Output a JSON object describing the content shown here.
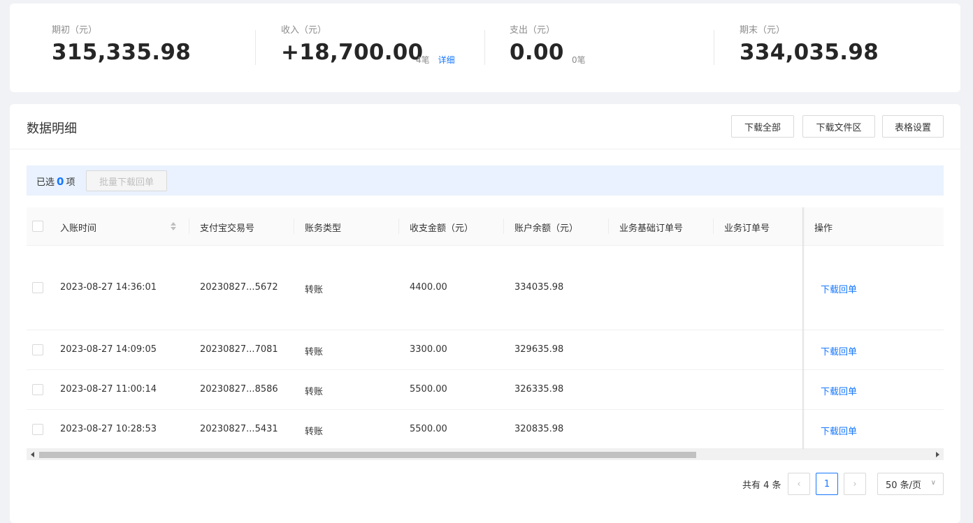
{
  "summary": {
    "opening": {
      "label": "期初（元）",
      "value": "315,335.98"
    },
    "income": {
      "label": "收入（元）",
      "value": "+18,700.00",
      "count": "4笔",
      "detail_link": "详细"
    },
    "expense": {
      "label": "支出（元）",
      "value": "0.00",
      "count": "0笔"
    },
    "closing": {
      "label": "期末（元）",
      "value": "334,035.98"
    }
  },
  "panel": {
    "title": "数据明细",
    "buttons": {
      "download_all": "下载全部",
      "download_area": "下载文件区",
      "table_settings": "表格设置"
    }
  },
  "selection": {
    "prefix": "已选",
    "count": "0",
    "suffix": "项",
    "batch_button": "批量下载回单"
  },
  "table": {
    "columns": [
      "入账时间",
      "支付宝交易号",
      "账务类型",
      "收支金额（元）",
      "账户余额（元）",
      "业务基础订单号",
      "业务订单号",
      "操作"
    ],
    "rows": [
      {
        "time": "2023-08-27 14:36:01",
        "trade_no": "20230827...5672",
        "type": "转账",
        "amount": "4400.00",
        "balance": "334035.98",
        "base_order": "",
        "order": "",
        "action": "下载回单"
      },
      {
        "time": "2023-08-27 14:09:05",
        "trade_no": "20230827...7081",
        "type": "转账",
        "amount": "3300.00",
        "balance": "329635.98",
        "base_order": "",
        "order": "",
        "action": "下载回单"
      },
      {
        "time": "2023-08-27 11:00:14",
        "trade_no": "20230827...8586",
        "type": "转账",
        "amount": "5500.00",
        "balance": "326335.98",
        "base_order": "",
        "order": "",
        "action": "下载回单"
      },
      {
        "time": "2023-08-27 10:28:53",
        "trade_no": "20230827...5431",
        "type": "转账",
        "amount": "5500.00",
        "balance": "320835.98",
        "base_order": "",
        "order": "",
        "action": "下载回单"
      }
    ]
  },
  "pagination": {
    "total": "共有 4 条",
    "current_page": "1",
    "page_size": "50 条/页",
    "prev_icon": "chevron-left-icon",
    "next_icon": "chevron-right-icon"
  },
  "colors": {
    "accent": "#1677ff",
    "selection_bg": "#e9f2fe"
  }
}
